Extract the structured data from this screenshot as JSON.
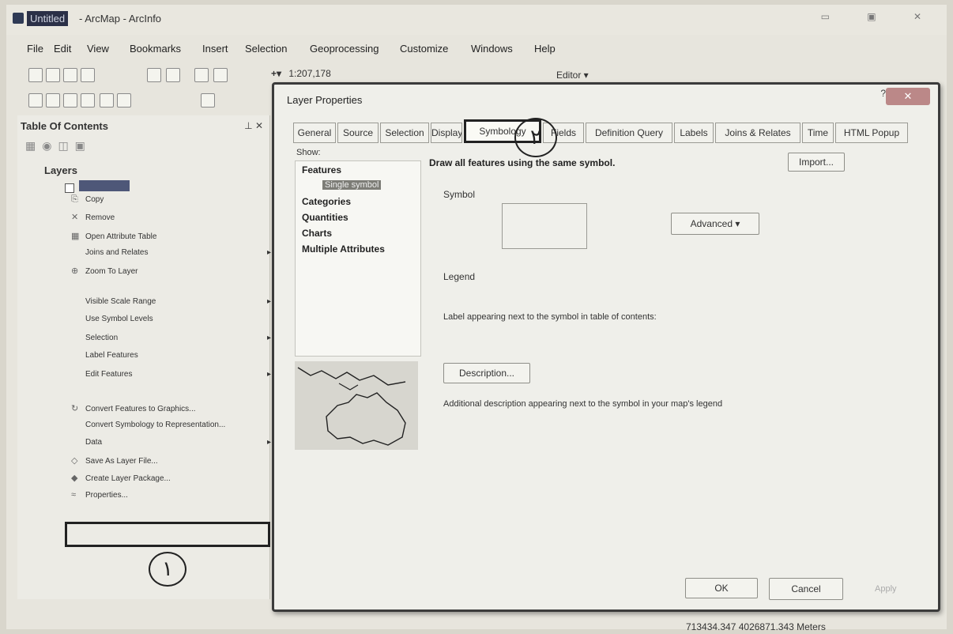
{
  "window": {
    "doc_name": "Untitled",
    "app_title": "- ArcMap - ArcInfo",
    "buttons": "▭ ▣ ✕"
  },
  "menu": [
    "File",
    "Edit",
    "View",
    "Bookmarks",
    "Insert",
    "Selection",
    "Geoprocessing",
    "Customize",
    "Windows",
    "Help"
  ],
  "toolbar": {
    "scale": "1:207,178",
    "editor_label": "Editor ▾"
  },
  "toc": {
    "title": "Table Of Contents",
    "pin": "⊥ ✕",
    "layers_label": "Layers",
    "context_menu": [
      {
        "label": "Copy",
        "icon": "copy-icon",
        "glyph": "⎘"
      },
      {
        "label": "Remove",
        "icon": "remove-icon",
        "glyph": "✕"
      },
      {
        "label": "Open Attribute Table",
        "icon": "table-icon",
        "glyph": "▦"
      },
      {
        "label": "Joins and Relates",
        "icon": "",
        "glyph": "",
        "submenu": true
      },
      {
        "label": "Zoom To Layer",
        "icon": "zoom-icon",
        "glyph": "⊕"
      },
      {
        "label": "Visible Scale Range",
        "icon": "",
        "glyph": "",
        "submenu": true
      },
      {
        "label": "Use Symbol Levels",
        "icon": "",
        "glyph": ""
      },
      {
        "label": "Selection",
        "icon": "",
        "glyph": "",
        "submenu": true
      },
      {
        "label": "Label Features",
        "icon": "",
        "glyph": ""
      },
      {
        "label": "Edit Features",
        "icon": "",
        "glyph": "",
        "submenu": true
      },
      {
        "label": "Convert Features to Graphics...",
        "icon": "convert-icon",
        "glyph": "↻"
      },
      {
        "label": "Convert Symbology to Representation...",
        "icon": "",
        "glyph": ""
      },
      {
        "label": "Data",
        "icon": "",
        "glyph": "",
        "submenu": true
      },
      {
        "label": "Save As Layer File...",
        "icon": "save-layer-icon",
        "glyph": "◇"
      },
      {
        "label": "Create Layer Package...",
        "icon": "package-icon",
        "glyph": "◆"
      },
      {
        "label": "Properties...",
        "icon": "properties-icon",
        "glyph": "≈"
      }
    ],
    "annotation_1": "١"
  },
  "dialog": {
    "title": "Layer Properties",
    "help": "?",
    "close": "✕",
    "tabs": [
      "General",
      "Source",
      "Selection",
      "Display",
      "Symbology",
      "Fields",
      "Definition Query",
      "Labels",
      "Joins & Relates",
      "Time",
      "HTML Popup"
    ],
    "active_tab": "Symbology",
    "annotation_2": "٢",
    "show_label": "Show:",
    "show_items": [
      "Features",
      "Categories",
      "Quantities",
      "Charts",
      "Multiple Attributes"
    ],
    "show_selected_sub": "Single symbol",
    "draw_text": "Draw all features using the same symbol.",
    "import_label": "Import...",
    "symbol_label": "Symbol",
    "advanced_label": "Advanced",
    "legend_label": "Legend",
    "label_text": "Label appearing next to the symbol in table of contents:",
    "description_button": "Description...",
    "description_text": "Additional description appearing next to the symbol in your map's legend",
    "ok": "OK",
    "cancel": "Cancel",
    "apply": "Apply"
  },
  "status": {
    "coordinates": "713434.347  4026871.343 Meters"
  }
}
